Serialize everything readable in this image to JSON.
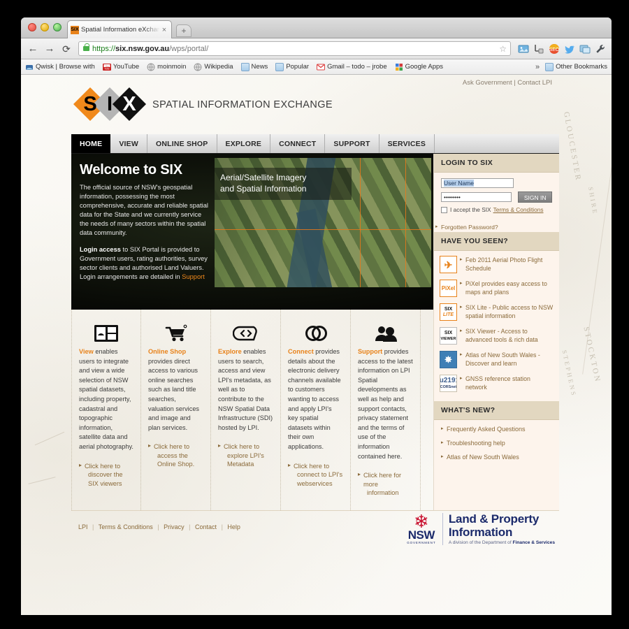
{
  "browser": {
    "tab": {
      "title": "Spatial Information eXchange",
      "favicon": "six-favicon",
      "close": "×"
    },
    "newtab_label": "+",
    "nav": {
      "back": "←",
      "forward": "→",
      "reload": "⟳"
    },
    "url": {
      "scheme": "https://",
      "host": "six.nsw.gov.au",
      "path": "/wps/portal/",
      "star": "☆"
    },
    "extensions": [
      "image-icon",
      "ruler-icon",
      "seo-icon",
      "twitter-icon",
      "screenshot-icon",
      "wrench-icon"
    ],
    "bookmarks": [
      {
        "label": "Qwisk | Browse with",
        "icon": "qwisk-icon"
      },
      {
        "label": "YouTube",
        "icon": "youtube-icon"
      },
      {
        "label": "moinmoin",
        "icon": "globe-icon"
      },
      {
        "label": "Wikipedia",
        "icon": "globe-icon"
      },
      {
        "label": "News",
        "icon": "folder-icon"
      },
      {
        "label": "Popular",
        "icon": "folder-icon"
      },
      {
        "label": "Gmail – todo – jrobe",
        "icon": "gmail-icon"
      },
      {
        "label": "Google Apps",
        "icon": "google-apps-icon"
      }
    ],
    "overflow": "»",
    "other_bookmarks": "Other Bookmarks"
  },
  "header": {
    "logo_letters": [
      "S",
      "I",
      "X"
    ],
    "tagline": "SPATIAL INFORMATION EXCHANGE",
    "links": {
      "ask": "Ask Government",
      "sep": "|",
      "contact": "Contact LPI"
    }
  },
  "nav_tabs": [
    {
      "label": "HOME",
      "active": true
    },
    {
      "label": "VIEW",
      "active": false
    },
    {
      "label": "ONLINE SHOP",
      "active": false
    },
    {
      "label": "EXPLORE",
      "active": false
    },
    {
      "label": "CONNECT",
      "active": false
    },
    {
      "label": "SUPPORT",
      "active": false
    },
    {
      "label": "SERVICES",
      "active": false
    }
  ],
  "hero": {
    "title": "Welcome to SIX",
    "paragraph": "The official source of NSW's geospatial information, possessing the most comprehensive, accurate and reliable spatial data for the State and we currently service the needs of many sectors within the spatial data community.",
    "para2_bold": "Login access",
    "para2_rest": " to SIX Portal is provided to Government users, rating authorities, survey sector clients and authorised Land Valuers. Login arrangements are detailed in ",
    "para2_link": "Support",
    "caption_line1": "Aerial/Satellite Imagery",
    "caption_line2": "and Spatial Information"
  },
  "features": [
    {
      "icon": "view-panels-icon",
      "keyword": "View",
      "text": " enables users to integrate and view a wide selection of NSW spatial datasets, including property, cadastral and topographic information, satellite data and aerial photography.",
      "cta_line1": "Click here to",
      "cta_line2": "discover the SIX viewers"
    },
    {
      "icon": "shopping-cart-icon",
      "keyword": "Online Shop",
      "text": " provides direct access to various online searches such as land title searches, valuation services and image and plan services.",
      "cta_line1": "Click here to",
      "cta_line2": "access the Online Shop."
    },
    {
      "icon": "code-brackets-icon",
      "keyword": "Explore",
      "text": " enables users to search, access and view LPI's metadata, as well as to contribute to the NSW Spatial Data Infrastructure (SDI) hosted by LPI.",
      "cta_line1": "Click here to",
      "cta_line2": "explore LPI's Metadata"
    },
    {
      "icon": "linked-rings-icon",
      "keyword": "Connect",
      "text": " provides details about the electronic delivery channels available to customers wanting to access and apply LPI's key spatial datasets within their own applications.",
      "cta_line1": "Click here to",
      "cta_line2": "connect to LPI's webservices"
    },
    {
      "icon": "people-icon",
      "keyword": "Support",
      "text": " provides access to the latest information on LPI Spatial developments as well as help and support contacts, privacy statement and the terms of use of the information contained here.",
      "cta_line1": "Click here for more",
      "cta_line2": "information"
    }
  ],
  "login": {
    "heading": "LOGIN TO SIX",
    "username_value": "User Name",
    "username_placeholder": "User Name",
    "password_value": "••••••••",
    "signin_label": "SIGN IN",
    "accept_text": "I accept the SIX",
    "terms_link": "Terms & Conditions",
    "forgotten": "Forgotten Password?"
  },
  "have_you_seen": {
    "heading": "HAVE YOU SEEN?",
    "items": [
      {
        "icon": "plane-icon",
        "icon_text": "✈",
        "text": "Feb 2011 Aerial Photo Flight Schedule"
      },
      {
        "icon": "pixel-logo-icon",
        "icon_text": "PiXel",
        "text": "PiXel provides easy access to maps and plans"
      },
      {
        "icon": "six-lite-logo-icon",
        "icon_text": "SIX LITE",
        "text": "SIX Lite - Public access to NSW spatial information"
      },
      {
        "icon": "six-viewer-logo-icon",
        "icon_text": "SIX VIEWER",
        "text": "SIX Viewer - Access to advanced tools & rich data"
      },
      {
        "icon": "atlas-compass-icon",
        "icon_text": "✸",
        "text": "Atlas of New South Wales - Discover and learn"
      },
      {
        "icon": "corsnet-logo-icon",
        "icon_text": "CORSnet",
        "text": "GNSS reference station network"
      }
    ]
  },
  "whats_new": {
    "heading": "WHAT'S NEW?",
    "items": [
      "Frequently Asked Questions",
      "Troubleshooting help",
      "Atlas of New South Wales"
    ]
  },
  "footer": {
    "links": [
      "LPI",
      "Terms & Conditions",
      "Privacy",
      "Contact",
      "Help"
    ],
    "separator": "|",
    "lpi_logo": {
      "nsw": "NSW",
      "nsw_sub": "GOVERNMENT",
      "line1": "Land & Property",
      "line2": "Information",
      "line3_prefix": "A division of the Department of ",
      "line3_bold": "Finance & Services"
    }
  },
  "map_background": {
    "words": [
      "GLOUCESTER",
      "SHIRE",
      "STEPHENS",
      "STOCKTON"
    ]
  },
  "colors": {
    "accent_orange": "#e8821a",
    "link_brown": "#8a6a3a",
    "rail_bg": "#fdf4ec",
    "rail_head": "#e2d7c0",
    "nsw_blue": "#1b2a6b",
    "waratah_red": "#c8102e"
  }
}
